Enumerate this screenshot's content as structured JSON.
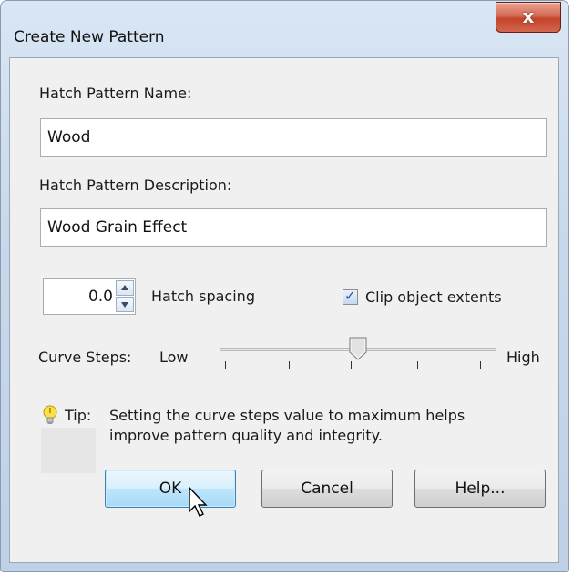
{
  "window": {
    "title": "Create New Pattern",
    "close_symbol": "x"
  },
  "name_field": {
    "label": "Hatch Pattern Name:",
    "value": "Wood"
  },
  "description_field": {
    "label": "Hatch Pattern Description:",
    "value": "Wood Grain Effect"
  },
  "spacing": {
    "value": "0.0",
    "label": "Hatch spacing"
  },
  "clip": {
    "label": "Clip object extents",
    "checked": true
  },
  "curve_steps": {
    "label": "Curve Steps:",
    "low_label": "Low",
    "high_label": "High",
    "level": 0.5,
    "tick_count": 5
  },
  "tip": {
    "prefix": "Tip:",
    "line1": "Setting the curve steps value to maximum helps",
    "line2": "improve pattern quality and integrity.",
    "icon": "lightbulb-icon"
  },
  "buttons": {
    "ok": "OK",
    "cancel": "Cancel",
    "help": "Help..."
  },
  "colors": {
    "accent": "#3c7fb1",
    "close": "#c4432a",
    "titlebar": "#d9e6f4"
  }
}
